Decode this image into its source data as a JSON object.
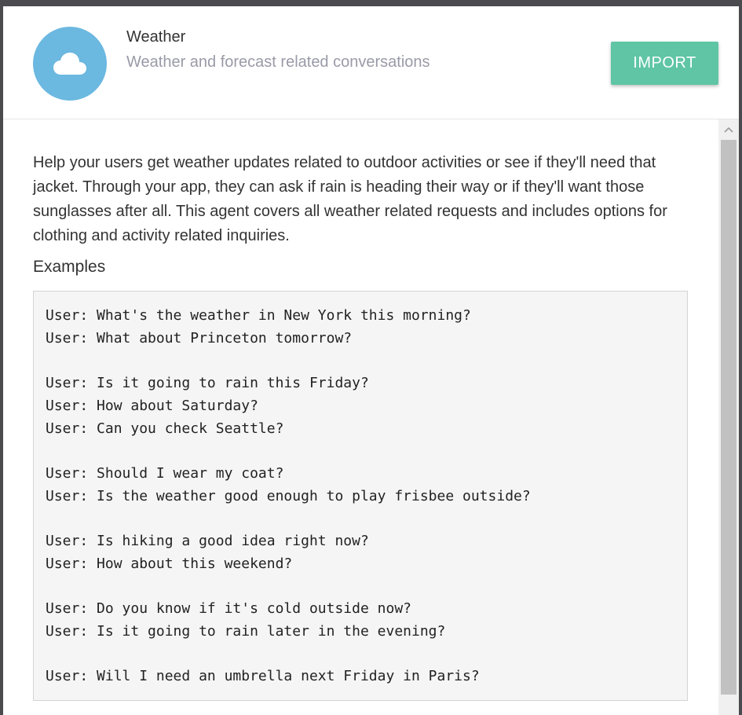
{
  "header": {
    "title": "Weather",
    "subtitle": "Weather and forecast related conversations",
    "import_label": "IMPORT",
    "avatar_icon": "cloud-icon",
    "avatar_color": "#6bb8e0",
    "button_color": "#5fc5a5"
  },
  "description": "Help your users get weather updates related to outdoor activities or see if they'll need that jacket. Through your app, they can ask if rain is heading their way or if they'll want those sunglasses after all. This agent covers all weather related requests and includes options for clothing and activity related inquiries.",
  "examples_label": "Examples",
  "examples": [
    [
      "User: What's the weather in New York this morning?",
      "User: What about Princeton tomorrow?"
    ],
    [
      "User: Is it going to rain this Friday?",
      "User: How about Saturday?",
      "User: Can you check Seattle?"
    ],
    [
      "User: Should I wear my coat?",
      "User: Is the weather good enough to play frisbee outside?"
    ],
    [
      "User: Is hiking a good idea right now?",
      "User: How about this weekend?"
    ],
    [
      "User: Do you know if it's cold outside now?",
      "User: Is it going to rain later in the evening?"
    ],
    [
      "User: Will I need an umbrella next Friday in Paris?"
    ]
  ]
}
